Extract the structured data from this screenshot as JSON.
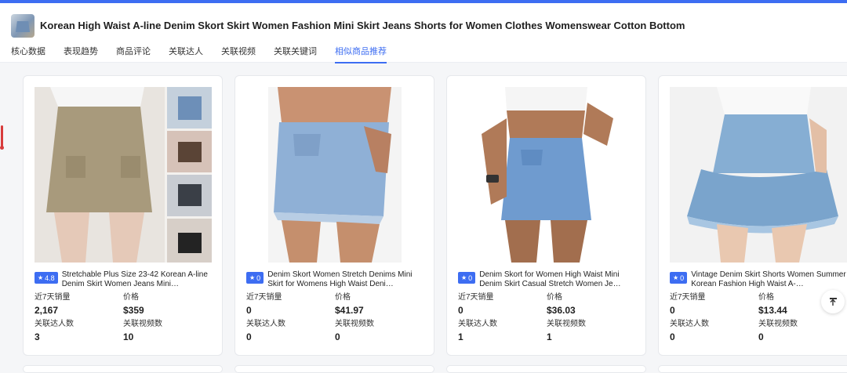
{
  "product": {
    "title": "Korean High Waist A-line Denim Skort Skirt Women Fashion Mini Skirt Jeans Shorts for Women Clothes Womenswear Cotton Bottom"
  },
  "tabs": [
    {
      "label": "核心数据"
    },
    {
      "label": "表现趋势"
    },
    {
      "label": "商品评论"
    },
    {
      "label": "关联达人"
    },
    {
      "label": "关联视频"
    },
    {
      "label": "关联关键词"
    },
    {
      "label": "相似商品推荐",
      "active": true
    }
  ],
  "labels": {
    "sales7": "近7天销量",
    "price": "价格",
    "creators": "关联达人数",
    "videos": "关联视频数"
  },
  "cards": [
    {
      "rating": "4.8",
      "name": "Stretchable Plus Size 23-42 Korean A-line Denim Skirt Women Jeans Mini…",
      "sales7": "2,167",
      "price": "$359",
      "creators": "3",
      "videos": "10"
    },
    {
      "rating": "0",
      "name": "Denim Skort Women Stretch Denims Mini Skirt for Womens High Waist Deni…",
      "sales7": "0",
      "price": "$41.97",
      "creators": "0",
      "videos": "0"
    },
    {
      "rating": "0",
      "name": "Denim Skort for Women High Waist Mini Denim Skirt Casual Stretch Women Je…",
      "sales7": "0",
      "price": "$36.03",
      "creators": "1",
      "videos": "1"
    },
    {
      "rating": "0",
      "name": "Vintage Denim Skirt Shorts Women Summer Korean Fashion High Waist A-…",
      "sales7": "0",
      "price": "$13.44",
      "creators": "0",
      "videos": "0"
    }
  ],
  "colors": {
    "accent": "#3d6df2"
  }
}
